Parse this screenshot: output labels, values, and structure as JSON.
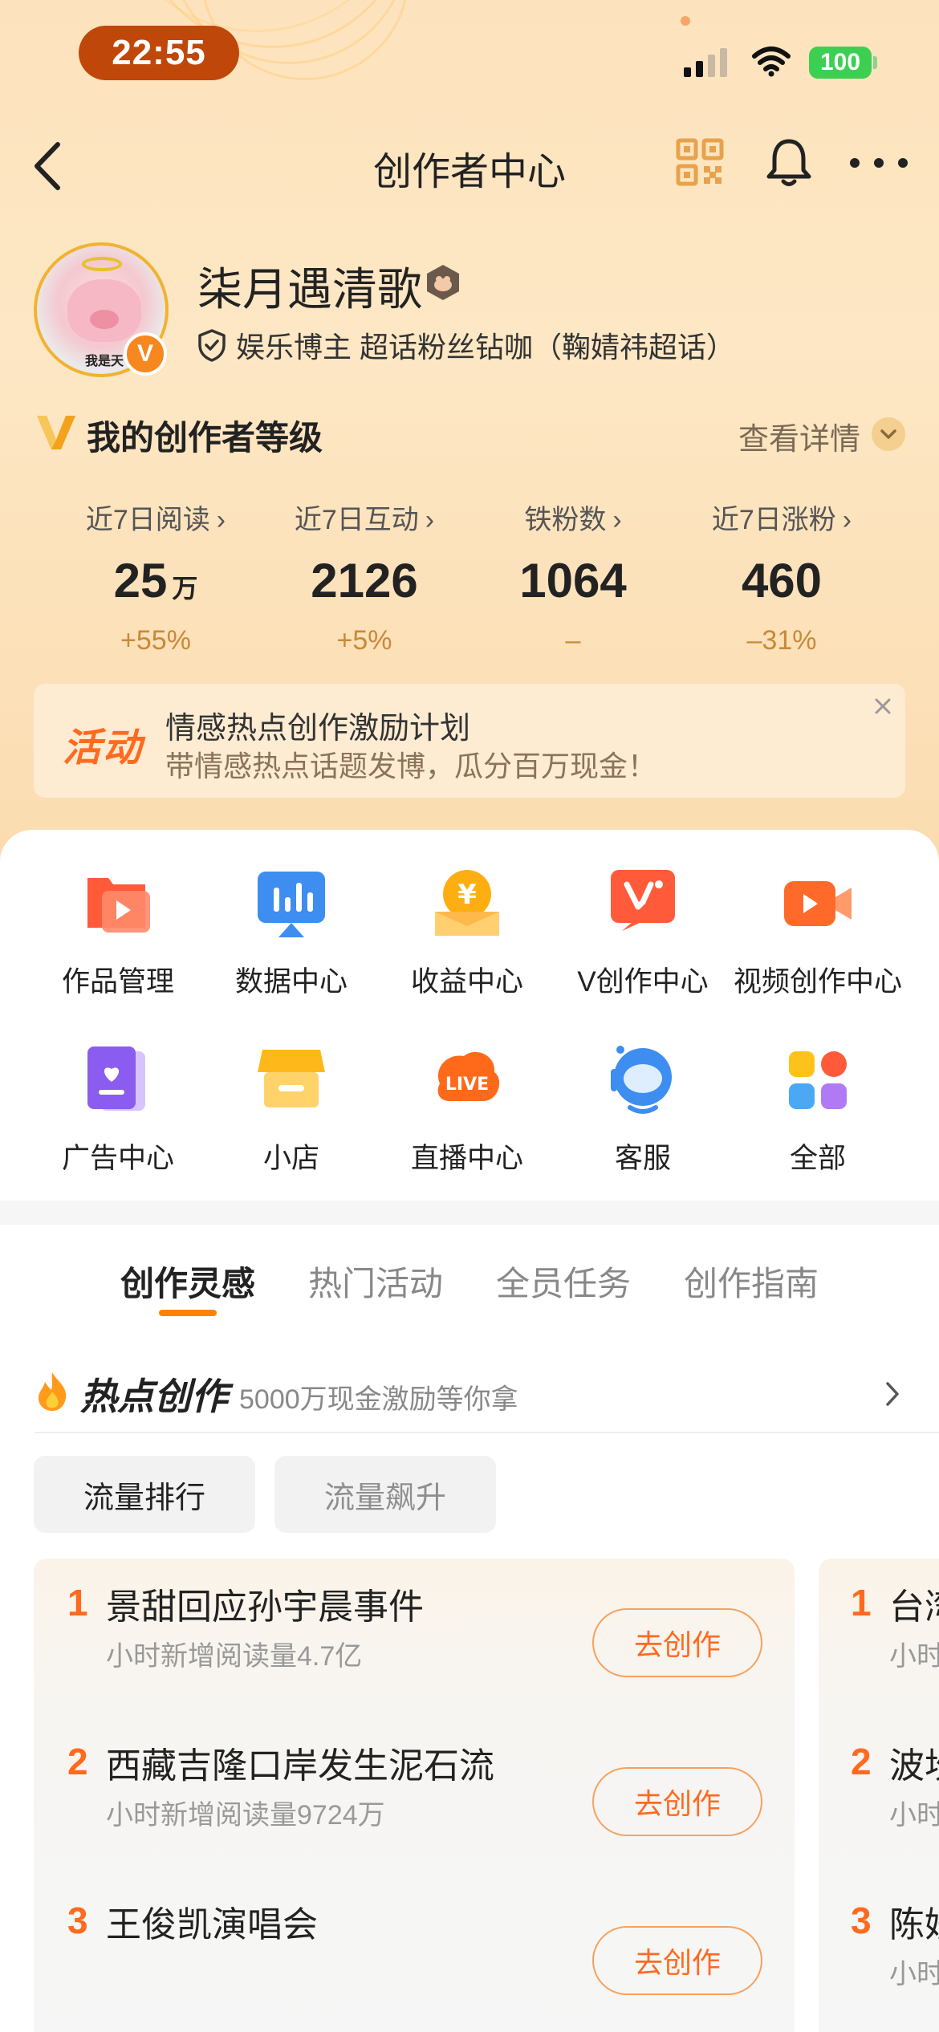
{
  "status": {
    "time": "22:55",
    "battery": "100"
  },
  "nav": {
    "title": "创作者中心"
  },
  "profile": {
    "name": "柒月遇清歌",
    "avatar_caption": "我是天",
    "verify_badge": "V",
    "verification": "娱乐博主 超话粉丝钻咖（鞠婧祎超话）"
  },
  "level": {
    "title": "我的创作者等级",
    "detail_link": "查看详情",
    "stats": [
      {
        "label": "近7日阅读",
        "value": "25",
        "unit": "万",
        "change": "+55%"
      },
      {
        "label": "近7日互动",
        "value": "2126",
        "unit": "",
        "change": "+5%"
      },
      {
        "label": "铁粉数",
        "value": "1064",
        "unit": "",
        "change": "–"
      },
      {
        "label": "近7日涨粉",
        "value": "460",
        "unit": "",
        "change": "–31%"
      }
    ]
  },
  "banner": {
    "tag": "活动",
    "title": "情感热点创作激励计划",
    "subtitle": "带情感热点话题发博，瓜分百万现金！"
  },
  "grid": [
    {
      "label": "作品管理",
      "icon": "works-folder-icon"
    },
    {
      "label": "数据中心",
      "icon": "data-chart-icon"
    },
    {
      "label": "收益中心",
      "icon": "income-coin-icon"
    },
    {
      "label": "V创作中心",
      "icon": "v-creator-icon"
    },
    {
      "label": "视频创作中心",
      "icon": "video-camera-icon"
    },
    {
      "label": "广告中心",
      "icon": "ad-book-icon"
    },
    {
      "label": "小店",
      "icon": "shop-icon"
    },
    {
      "label": "直播中心",
      "icon": "live-icon"
    },
    {
      "label": "客服",
      "icon": "customer-service-icon"
    },
    {
      "label": "全部",
      "icon": "all-apps-icon"
    }
  ],
  "tabs": [
    "创作灵感",
    "热门活动",
    "全员任务",
    "创作指南"
  ],
  "hot": {
    "title": "热点创作",
    "subtitle": "5000万现金激励等你拿"
  },
  "filters": [
    "流量排行",
    "流量飙升"
  ],
  "ranking": [
    {
      "num": "1",
      "title": "景甜回应孙宇晨事件",
      "sub": "小时新增阅读量4.7亿",
      "action": "去创作"
    },
    {
      "num": "2",
      "title": "西藏吉隆口岸发生泥石流",
      "sub": "小时新增阅读量9724万",
      "action": "去创作"
    },
    {
      "num": "3",
      "title": "王俊凯演唱会",
      "sub": "",
      "action": "去创作"
    }
  ],
  "ranking_peek": [
    {
      "num": "1",
      "title": "台湾",
      "sub": "小时"
    },
    {
      "num": "2",
      "title": "波坎",
      "sub": "小时"
    },
    {
      "num": "3",
      "title": "陈妍",
      "sub": "小时"
    }
  ],
  "colors": {
    "accent": "#ff6a1f",
    "tab_underline": "#ff8200",
    "time_pill": "#c0470a",
    "battery": "#3ecf52"
  }
}
